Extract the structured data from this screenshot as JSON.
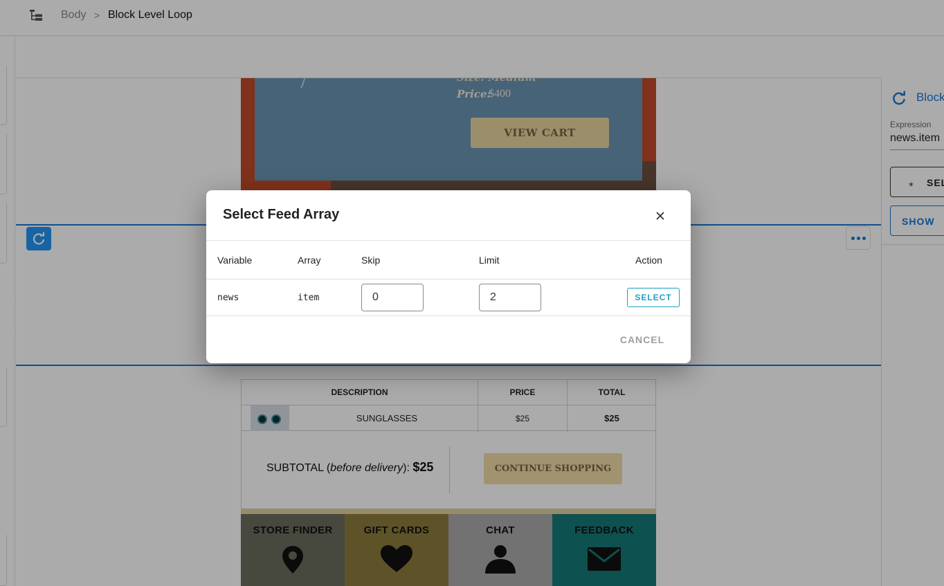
{
  "breadcrumb": {
    "root": "Body",
    "separator": ">",
    "current": "Block Level Loop"
  },
  "preview": {
    "hero": {
      "size_text": "Size: Medium",
      "price_label": "Price:",
      "price_value": "$400",
      "view_cart_label": "VIEW CART"
    },
    "order_table": {
      "headers": [
        "DESCRIPTION",
        "PRICE",
        "TOTAL"
      ],
      "rows": [
        {
          "description": "SUNGLASSES",
          "price": "$25",
          "total": "$25"
        }
      ]
    },
    "subtotal": {
      "label": "SUBTOTAL (",
      "label_italic": "before delivery",
      "label_end": "): ",
      "value": "$25"
    },
    "continue_label": "CONTINUE SHOPPING",
    "tiles": [
      {
        "label": "STORE FINDER",
        "icon": "location-pin-icon",
        "color": "#6b6e5f"
      },
      {
        "label": "GIFT CARDS",
        "icon": "heart-icon",
        "color": "#8c7d3c"
      },
      {
        "label": "CHAT",
        "icon": "person-icon",
        "color": "#ababab"
      },
      {
        "label": "FEEDBACK",
        "icon": "envelope-icon",
        "color": "#157a7a"
      }
    ]
  },
  "right_panel": {
    "title": "Block",
    "expression_label": "Expression",
    "expression_value": "news.item",
    "select_label": "SELECT",
    "show_label": "SHOW"
  },
  "modal": {
    "title": "Select Feed Array",
    "columns": [
      "Variable",
      "Array",
      "Skip",
      "Limit",
      "Action"
    ],
    "rows": [
      {
        "variable": "news",
        "array": "item",
        "skip": "0",
        "limit": "2",
        "action_label": "SELECT"
      }
    ],
    "cancel_label": "CANCEL"
  },
  "colors": {
    "accent": "#1976d2",
    "select_button": "#1ba0c4",
    "overlay": "rgba(0,0,0,0.33)"
  }
}
